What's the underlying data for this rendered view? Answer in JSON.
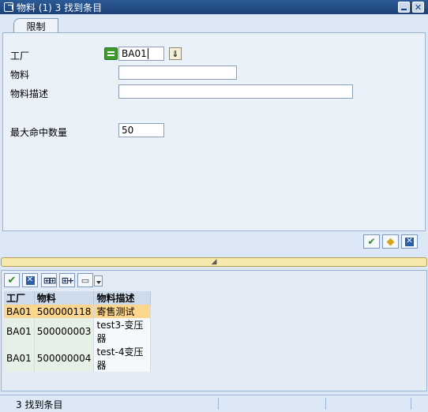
{
  "window": {
    "title": "物料 (1)    3 找到条目",
    "minimize_label": "",
    "close_label": "✕"
  },
  "tabs": [
    {
      "label": "限制",
      "active": true
    }
  ],
  "form": {
    "plant_label": "工厂",
    "plant_value": "BA01",
    "material_label": "物料",
    "material_value": "",
    "material_desc_label": "物料描述",
    "material_desc_value": "",
    "max_hits_label": "最大命中数量",
    "max_hits_value": "50"
  },
  "dialog_buttons": [
    {
      "icon": "checkmark-icon",
      "glyph": "✔"
    },
    {
      "icon": "multiple-selection-icon",
      "glyph": "◆"
    },
    {
      "icon": "cancel-icon",
      "glyph": "✕"
    }
  ],
  "splitter_glyph": "◢",
  "result_toolbar": {
    "ok_glyph": "✔",
    "cancel_glyph": "✕",
    "find_glyph": "⊞⊞",
    "find_next_glyph": "⊞+",
    "print_glyph": "▭"
  },
  "results": {
    "columns": [
      "工厂",
      "物料",
      "物料描述"
    ],
    "rows": [
      [
        "BA01",
        "500000118",
        "寄售测试"
      ],
      [
        "BA01",
        "500000003",
        "test3-变压器"
      ],
      [
        "BA01",
        "500000004",
        "test-4变压器"
      ]
    ],
    "selected_row": 0
  },
  "status": {
    "text": "3 找到条目"
  },
  "colors": {
    "title_bar": "#1b4177",
    "selected_row": "#fcd68c",
    "splitter": "#f5e9ad"
  }
}
